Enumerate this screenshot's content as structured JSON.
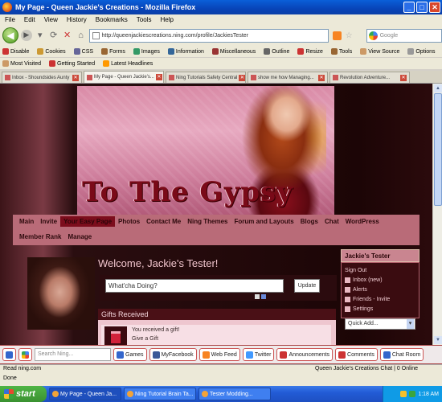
{
  "window": {
    "title": "My Page - Queen Jackie's Creations - Mozilla Firefox"
  },
  "menubar": [
    "File",
    "Edit",
    "View",
    "History",
    "Bookmarks",
    "Tools",
    "Help"
  ],
  "navbar": {
    "url": "http://queenjackiescreations.ning.com/profile/JackiesTester",
    "search_placeholder": "Google"
  },
  "bookmarks_row1": [
    {
      "label": "Disable",
      "color": "#c33"
    },
    {
      "label": "Cookies",
      "color": "#c93"
    },
    {
      "label": "CSS",
      "color": "#669"
    },
    {
      "label": "Forms",
      "color": "#963"
    },
    {
      "label": "Images",
      "color": "#396"
    },
    {
      "label": "Information",
      "color": "#369"
    },
    {
      "label": "Miscellaneous",
      "color": "#933"
    },
    {
      "label": "Outline",
      "color": "#666"
    },
    {
      "label": "Resize",
      "color": "#c33"
    },
    {
      "label": "Tools",
      "color": "#963"
    },
    {
      "label": "View Source",
      "color": "#c96"
    },
    {
      "label": "Options",
      "color": "#999"
    }
  ],
  "bookmarks_row2": [
    {
      "label": "Most Visited",
      "color": "#c96"
    },
    {
      "label": "Getting Started",
      "color": "#c33"
    },
    {
      "label": "Latest Headlines",
      "color": "#f90"
    }
  ],
  "tabs": [
    {
      "label": "Inbox - Shoundsides Aunty",
      "active": false
    },
    {
      "label": "My Page - Queen Jackie's...",
      "active": true
    },
    {
      "label": "Ning Tutorials Safety Central",
      "active": false
    },
    {
      "label": "show me how Managing...",
      "active": false
    },
    {
      "label": "Revolution Adventure...",
      "active": false
    }
  ],
  "site": {
    "banner_title": "To The Gypsy",
    "nav_row1": [
      "Main",
      "Invite",
      "Your Easy Page",
      "Photos",
      "Contact Me",
      "Ning Themes",
      "Forum and Layouts",
      "Blogs",
      "Chat",
      "WordPress"
    ],
    "nav_row2": [
      "Member Rank",
      "Manage"
    ],
    "active_nav": "Your Easy Page",
    "welcome": "Welcome, Jackie's Tester!",
    "status_placeholder": "What'cha Doing?",
    "update_button": "Update",
    "gifts_header": "Gifts Received",
    "gift_text": "You received a gift!",
    "gift_from": "Give a Gift",
    "sidebar_title": "Jackie's Tester",
    "sidebar_items": [
      "Sign Out",
      "Inbox (new)",
      "Alerts",
      "Friends - Invite",
      "Settings"
    ],
    "quick_add": "Quick Add..."
  },
  "ningbar": {
    "search_placeholder": "Search Ning...",
    "buttons": [
      {
        "label": "Games",
        "color": "#36c"
      },
      {
        "label": "MyFacebook",
        "color": "#3b5998"
      },
      {
        "label": "Web Feed",
        "color": "#f78422"
      },
      {
        "label": "Twitter",
        "color": "#4099ff"
      },
      {
        "label": "Announcements",
        "color": "#c33"
      },
      {
        "label": "Comments",
        "color": "#c33"
      },
      {
        "label": "Chat Room",
        "color": "#36c"
      }
    ]
  },
  "statusbar": {
    "left": "Read ning.com",
    "right": "Queen Jackie's Creations Chat | 0 Online",
    "done": "Done"
  },
  "taskbar": {
    "start": "start",
    "tasks": [
      {
        "label": "My Page - Queen Ja...",
        "active": true
      },
      {
        "label": "Ning Tutorial Brain Ta...",
        "active": false
      },
      {
        "label": "Tester Modding...",
        "active": false
      }
    ],
    "clock": "1:18 AM"
  }
}
